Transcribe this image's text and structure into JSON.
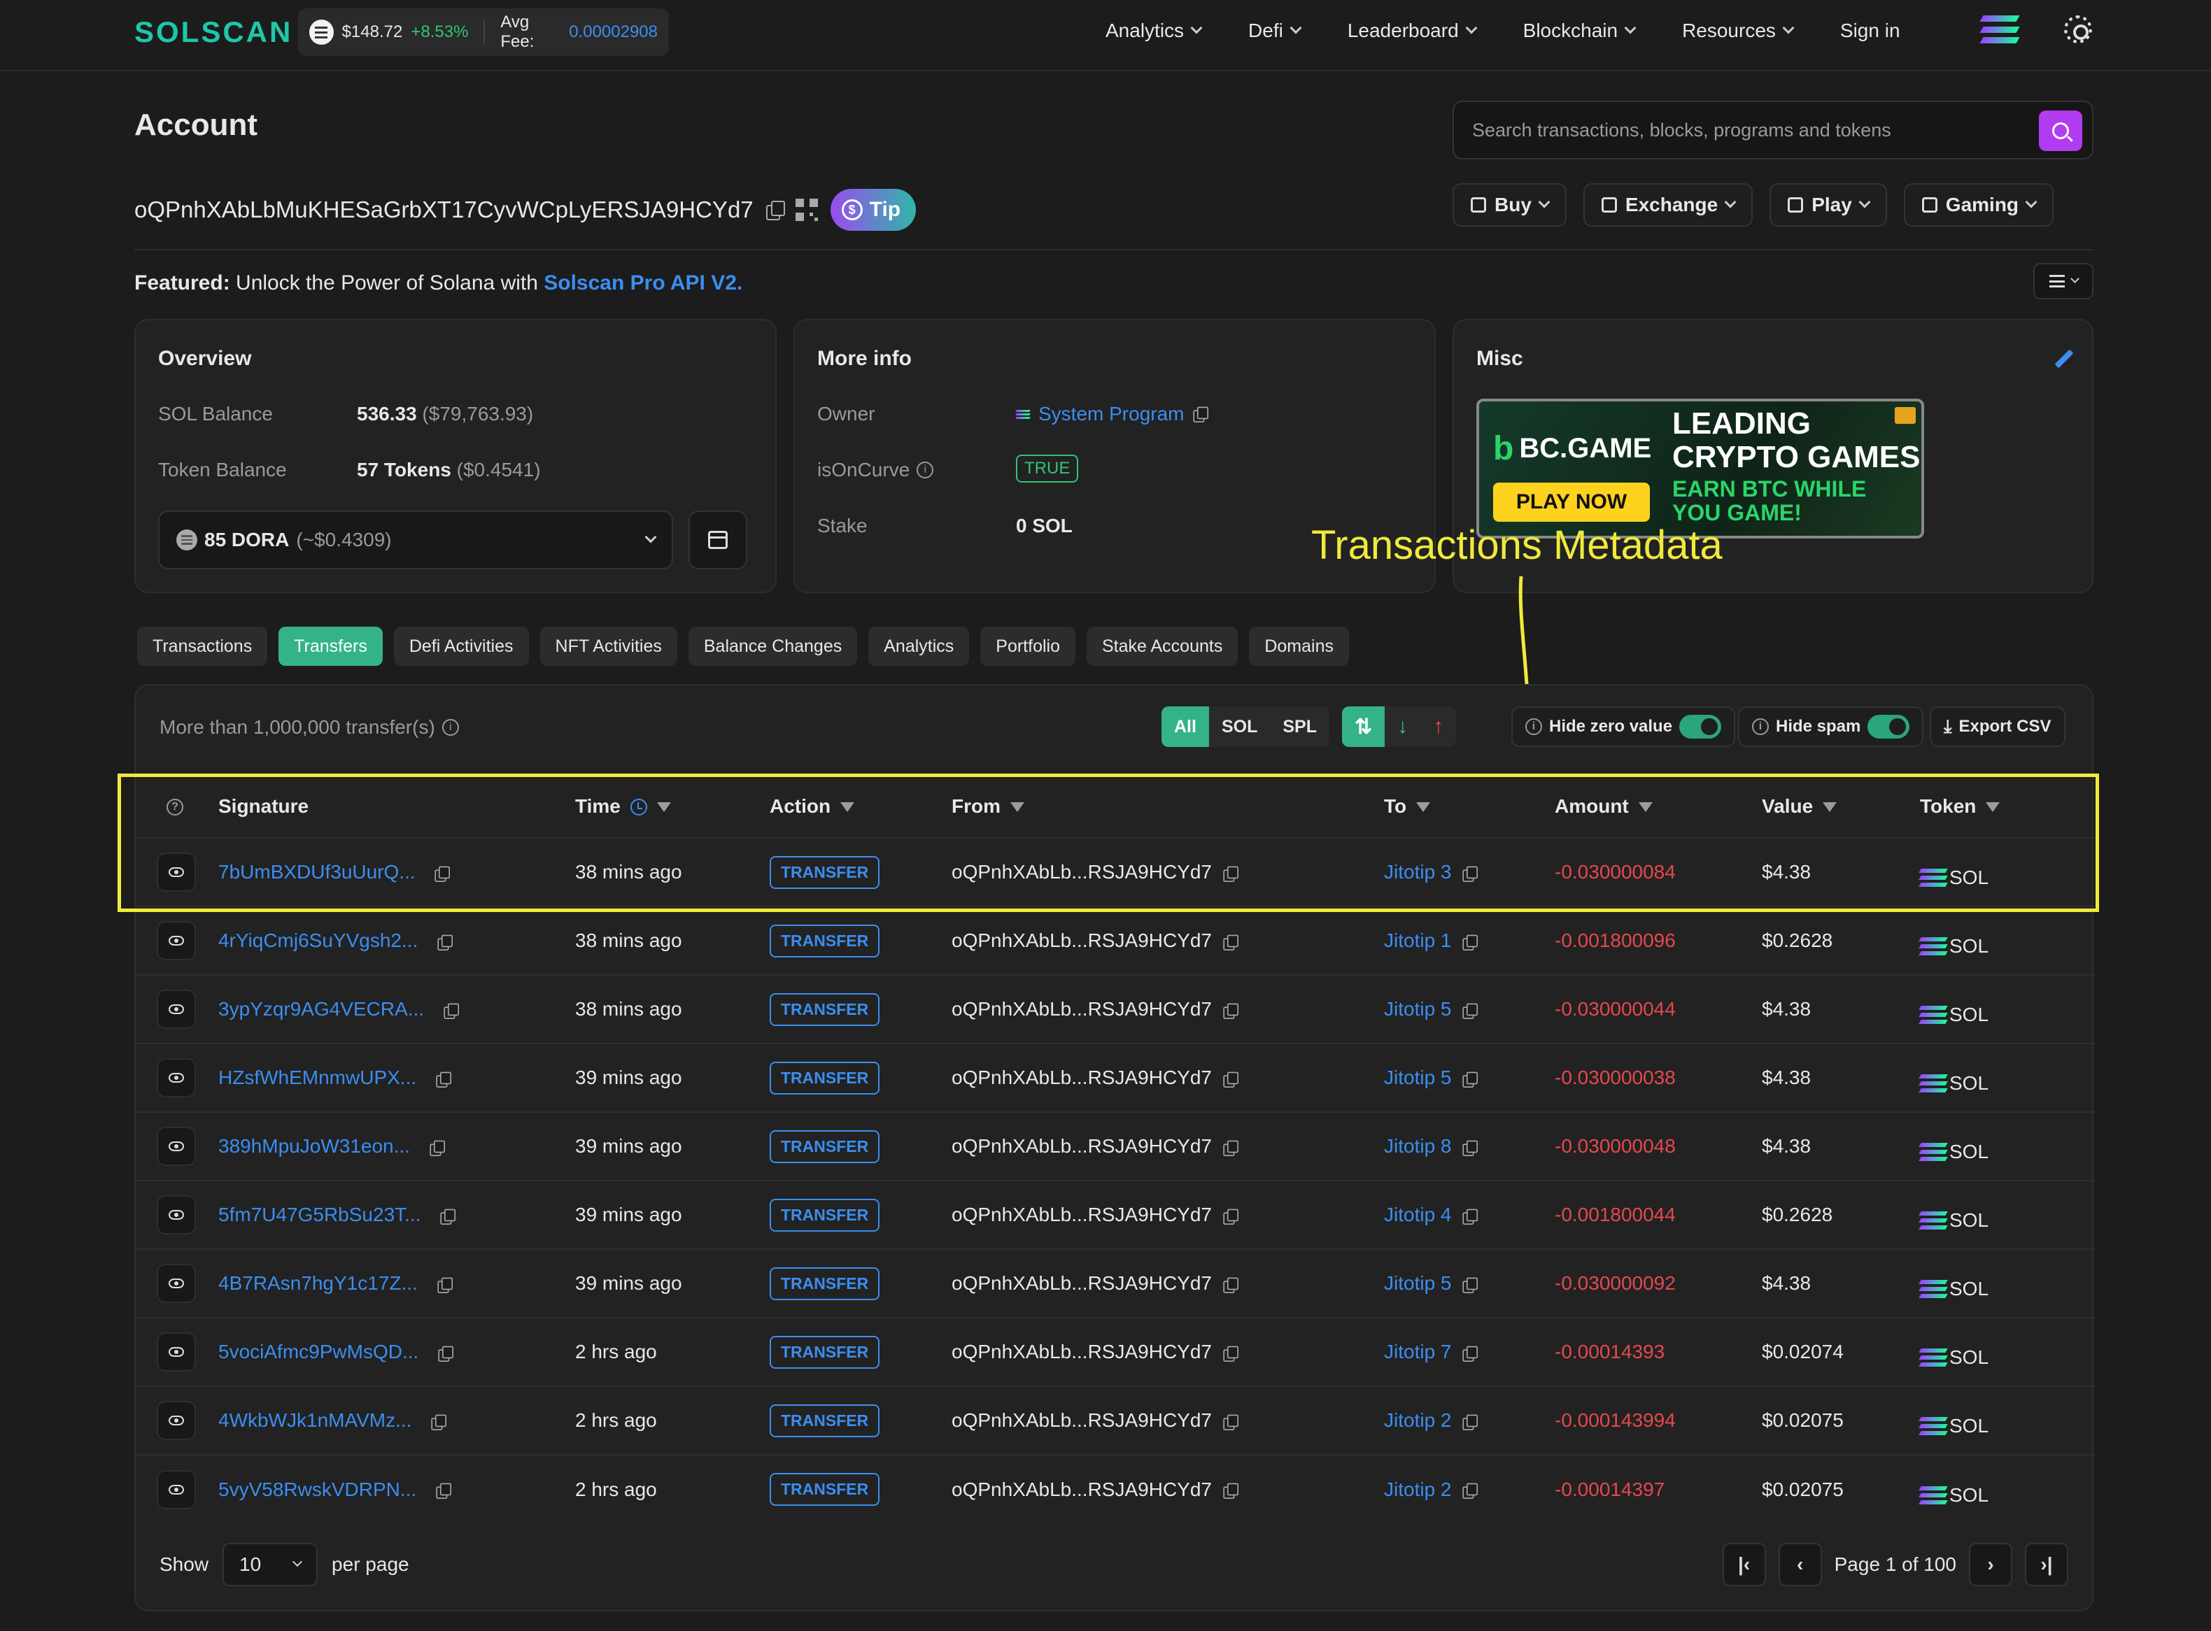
{
  "nav": {
    "logo": "SOLSCAN",
    "sol_price": "$148.72",
    "sol_change": "+8.53%",
    "avg_fee_label": "Avg Fee:",
    "avg_fee_value": "0.00002908",
    "menu": [
      {
        "label": "Analytics"
      },
      {
        "label": "Defi"
      },
      {
        "label": "Leaderboard"
      },
      {
        "label": "Blockchain"
      },
      {
        "label": "Resources"
      }
    ],
    "sign_in": "Sign in"
  },
  "header": {
    "title": "Account",
    "search_placeholder": "Search transactions, blocks, programs and tokens",
    "address": "oQPnhXAbLbMuKHESaGrbXT17CyvWCpLyERSJA9HCYd7",
    "tip": "Tip",
    "actions": [
      {
        "label": "Buy"
      },
      {
        "label": "Exchange"
      },
      {
        "label": "Play"
      },
      {
        "label": "Gaming"
      }
    ]
  },
  "featured": {
    "prefix": "Featured:",
    "text": " Unlock the Power of Solana with ",
    "link": "Solscan Pro API V2."
  },
  "overview": {
    "title": "Overview",
    "sol_balance_label": "SOL Balance",
    "sol_balance": "536.33",
    "sol_balance_usd": "($79,763.93)",
    "token_balance_label": "Token Balance",
    "token_balance": "57 Tokens",
    "token_balance_usd": "($0.4541)",
    "selected_token": "85 DORA",
    "selected_token_usd": "(~$0.4309)"
  },
  "more_info": {
    "title": "More info",
    "owner_label": "Owner",
    "owner_value": "System Program",
    "curve_label": "isOnCurve",
    "curve_value": "TRUE",
    "stake_label": "Stake",
    "stake_value": "0 SOL"
  },
  "misc": {
    "title": "Misc",
    "ad": {
      "brand": "BC.GAME",
      "headline_1": "LEADING",
      "headline_2": "CRYPTO GAMES",
      "sub_1": "EARN BTC WHILE",
      "sub_2": "YOU GAME!",
      "cta": "PLAY NOW"
    }
  },
  "annotation": "Transactions Metadata",
  "tabs": [
    {
      "label": "Transactions",
      "active": false
    },
    {
      "label": "Transfers",
      "active": true
    },
    {
      "label": "Defi Activities",
      "active": false
    },
    {
      "label": "NFT Activities",
      "active": false
    },
    {
      "label": "Balance Changes",
      "active": false
    },
    {
      "label": "Analytics",
      "active": false
    },
    {
      "label": "Portfolio",
      "active": false
    },
    {
      "label": "Stake Accounts",
      "active": false
    },
    {
      "label": "Domains",
      "active": false
    }
  ],
  "transfers": {
    "count_text": "More than 1,000,000 transfer(s)",
    "filters": {
      "all": "All",
      "sol": "SOL",
      "spl": "SPL"
    },
    "hide_zero": "Hide zero value",
    "hide_spam": "Hide spam",
    "export": "Export CSV",
    "columns": [
      "Signature",
      "Time",
      "Action",
      "From",
      "To",
      "Amount",
      "Value",
      "Token"
    ],
    "rows": [
      {
        "signature": "7bUmBXDUf3uUurQ...",
        "time": "38 mins ago",
        "action": "TRANSFER",
        "from": "oQPnhXAbLb...RSJA9HCYd7",
        "to": "Jitotip 3",
        "amount": "-0.030000084",
        "value": "$4.38",
        "token": "SOL"
      },
      {
        "signature": "4rYiqCmj6SuYVgsh2...",
        "time": "38 mins ago",
        "action": "TRANSFER",
        "from": "oQPnhXAbLb...RSJA9HCYd7",
        "to": "Jitotip 1",
        "amount": "-0.001800096",
        "value": "$0.2628",
        "token": "SOL"
      },
      {
        "signature": "3ypYzqr9AG4VECRA...",
        "time": "38 mins ago",
        "action": "TRANSFER",
        "from": "oQPnhXAbLb...RSJA9HCYd7",
        "to": "Jitotip 5",
        "amount": "-0.030000044",
        "value": "$4.38",
        "token": "SOL"
      },
      {
        "signature": "HZsfWhEMnmwUPX...",
        "time": "39 mins ago",
        "action": "TRANSFER",
        "from": "oQPnhXAbLb...RSJA9HCYd7",
        "to": "Jitotip 5",
        "amount": "-0.030000038",
        "value": "$4.38",
        "token": "SOL"
      },
      {
        "signature": "389hMpuJoW31eon...",
        "time": "39 mins ago",
        "action": "TRANSFER",
        "from": "oQPnhXAbLb...RSJA9HCYd7",
        "to": "Jitotip 8",
        "amount": "-0.030000048",
        "value": "$4.38",
        "token": "SOL"
      },
      {
        "signature": "5fm7U47G5RbSu23T...",
        "time": "39 mins ago",
        "action": "TRANSFER",
        "from": "oQPnhXAbLb...RSJA9HCYd7",
        "to": "Jitotip 4",
        "amount": "-0.001800044",
        "value": "$0.2628",
        "token": "SOL"
      },
      {
        "signature": "4B7RAsn7hgY1c17Z...",
        "time": "39 mins ago",
        "action": "TRANSFER",
        "from": "oQPnhXAbLb...RSJA9HCYd7",
        "to": "Jitotip 5",
        "amount": "-0.030000092",
        "value": "$4.38",
        "token": "SOL"
      },
      {
        "signature": "5vociAfmc9PwMsQD...",
        "time": "2 hrs ago",
        "action": "TRANSFER",
        "from": "oQPnhXAbLb...RSJA9HCYd7",
        "to": "Jitotip 7",
        "amount": "-0.00014393",
        "value": "$0.02074",
        "token": "SOL"
      },
      {
        "signature": "4WkbWJk1nMAVMz...",
        "time": "2 hrs ago",
        "action": "TRANSFER",
        "from": "oQPnhXAbLb...RSJA9HCYd7",
        "to": "Jitotip 2",
        "amount": "-0.000143994",
        "value": "$0.02075",
        "token": "SOL"
      },
      {
        "signature": "5vyV58RwskVDRPN...",
        "time": "2 hrs ago",
        "action": "TRANSFER",
        "from": "oQPnhXAbLb...RSJA9HCYd7",
        "to": "Jitotip 2",
        "amount": "-0.00014397",
        "value": "$0.02075",
        "token": "SOL"
      }
    ],
    "pagination": {
      "show_label": "Show",
      "per_page_value": "10",
      "per_page_label": "per page",
      "page_text": "Page 1 of 100"
    }
  }
}
